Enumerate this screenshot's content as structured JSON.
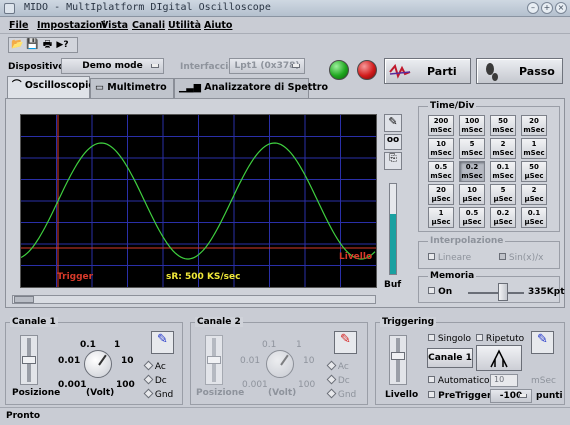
{
  "window": {
    "title": "MIDO - MultIplatform DIgital Oscilloscope"
  },
  "menu": [
    "File",
    "Impostazioni",
    "Vista",
    "Canali",
    "Utilità",
    "Aiuto"
  ],
  "device": {
    "label": "Dispositivo",
    "value": "Demo mode"
  },
  "interface": {
    "label": "Interfaccia",
    "value": "Lpt1 (0x378)"
  },
  "buttons": {
    "start": "Parti",
    "step": "Passo"
  },
  "tabs": [
    "Oscilloscopio",
    "Multimetro",
    "Analizzatore di Spettro"
  ],
  "scope": {
    "trigger": "Trigger",
    "level": "Livello",
    "sample_rate": "sR: 500 KS/sec",
    "buf": "Buf"
  },
  "timediv": {
    "title": "Time/Div",
    "buttons": [
      [
        "200",
        "mSec"
      ],
      [
        "100",
        "mSec"
      ],
      [
        "50",
        "mSec"
      ],
      [
        "20",
        "mSec"
      ],
      [
        "10",
        "mSec"
      ],
      [
        "5",
        "mSec"
      ],
      [
        "2",
        "mSec"
      ],
      [
        "1",
        "mSec"
      ],
      [
        "0.5",
        "mSec"
      ],
      [
        "0.2",
        "mSec"
      ],
      [
        "0.1",
        "mSec"
      ],
      [
        "50",
        "µSec"
      ],
      [
        "20",
        "µSec"
      ],
      [
        "10",
        "µSec"
      ],
      [
        "5",
        "µSec"
      ],
      [
        "2",
        "µSec"
      ],
      [
        "1",
        "µSec"
      ],
      [
        "0.5",
        "µSec"
      ],
      [
        "0.2",
        "µSec"
      ],
      [
        "0.1",
        "µSec"
      ]
    ],
    "selected_index": 9
  },
  "interp": {
    "title": "Interpolazione",
    "linear": "Lineare",
    "sinx": "Sin(x)/x"
  },
  "memory": {
    "title": "Memoria",
    "on": "On",
    "value": "335Kpt"
  },
  "ch1": {
    "title": "Canale 1",
    "pos": "Posizione",
    "volt": "(Volt)",
    "scale": [
      "0.1",
      "1",
      "0.01",
      "10",
      "0.001",
      "100"
    ],
    "couplings": [
      "Ac",
      "Dc",
      "Gnd"
    ]
  },
  "ch2": {
    "title": "Canale 2",
    "pos": "Posizione",
    "volt": "(Volt)",
    "scale": [
      "0.1",
      "1",
      "0.01",
      "10",
      "0.001",
      "100"
    ],
    "couplings": [
      "Ac",
      "Dc",
      "Gnd"
    ]
  },
  "trig": {
    "title": "Triggering",
    "level": "Livello",
    "single": "Singolo",
    "repeat": "Ripetuto",
    "channel": "Canale 1",
    "auto": "Automatico",
    "auto_value": "10",
    "auto_unit": "mSec",
    "pretrigger": "PreTrigger",
    "pre_value": "-100",
    "pre_unit": "punti"
  },
  "status": "Pronto",
  "colors": {
    "trace": "#3fcf3f",
    "grid": "#2a2fa8",
    "trigger": "#d83a2a",
    "level": "#d83a2a",
    "sr": "#f0e83a"
  }
}
